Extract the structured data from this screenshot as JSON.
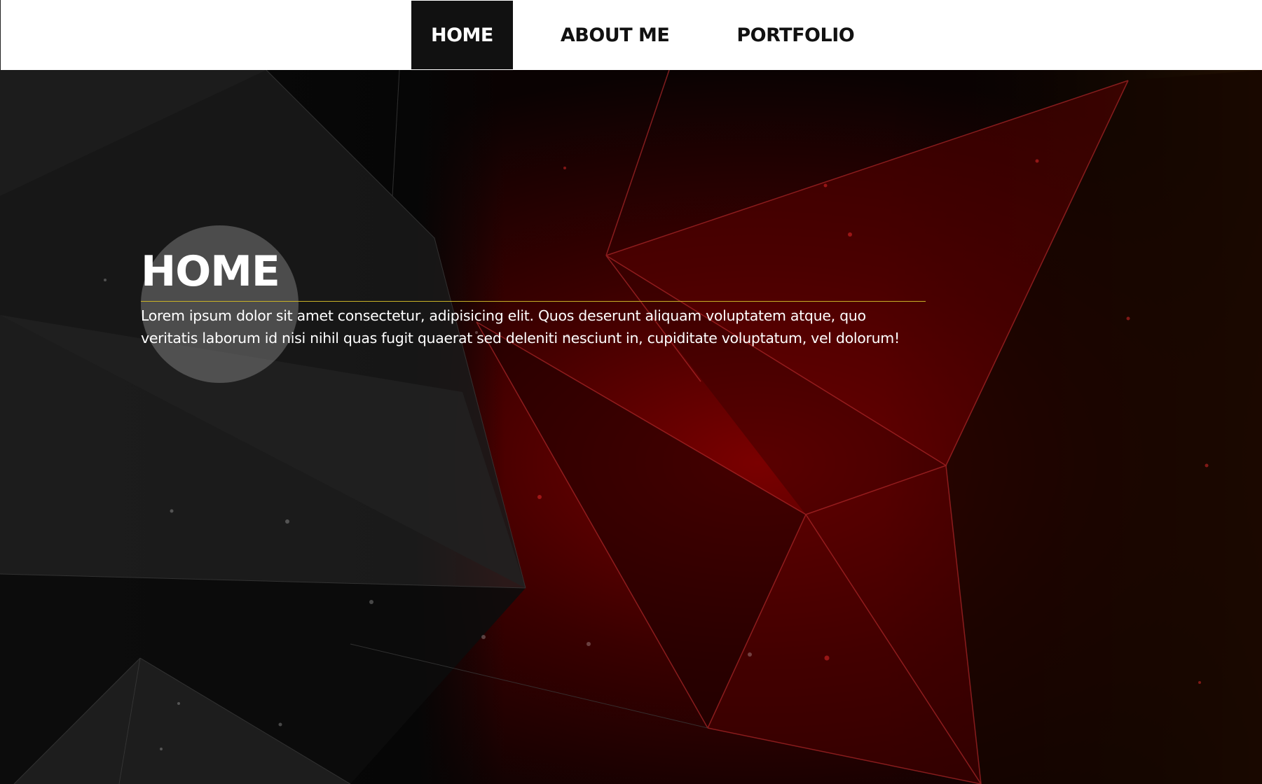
{
  "nav": {
    "items": [
      {
        "label": "HOME",
        "active": true
      },
      {
        "label": "ABOUT ME",
        "active": false
      },
      {
        "label": "PORTFOLIO",
        "active": false
      }
    ]
  },
  "hero": {
    "title": "HOME",
    "text": "Lorem ipsum dolor sit amet consectetur, adipisicing elit. Quos deserunt aliquam voluptatem atque, quo veritatis laborum id nisi nihil quas fugit quaerat sed deleniti nesciunt in, cupiditate voluptatum, vel dolorum!"
  },
  "colors": {
    "nav_bg": "#ffffff",
    "nav_active_bg": "#111111",
    "accent_line": "#c9b227",
    "bg_red": "#6a0000"
  }
}
